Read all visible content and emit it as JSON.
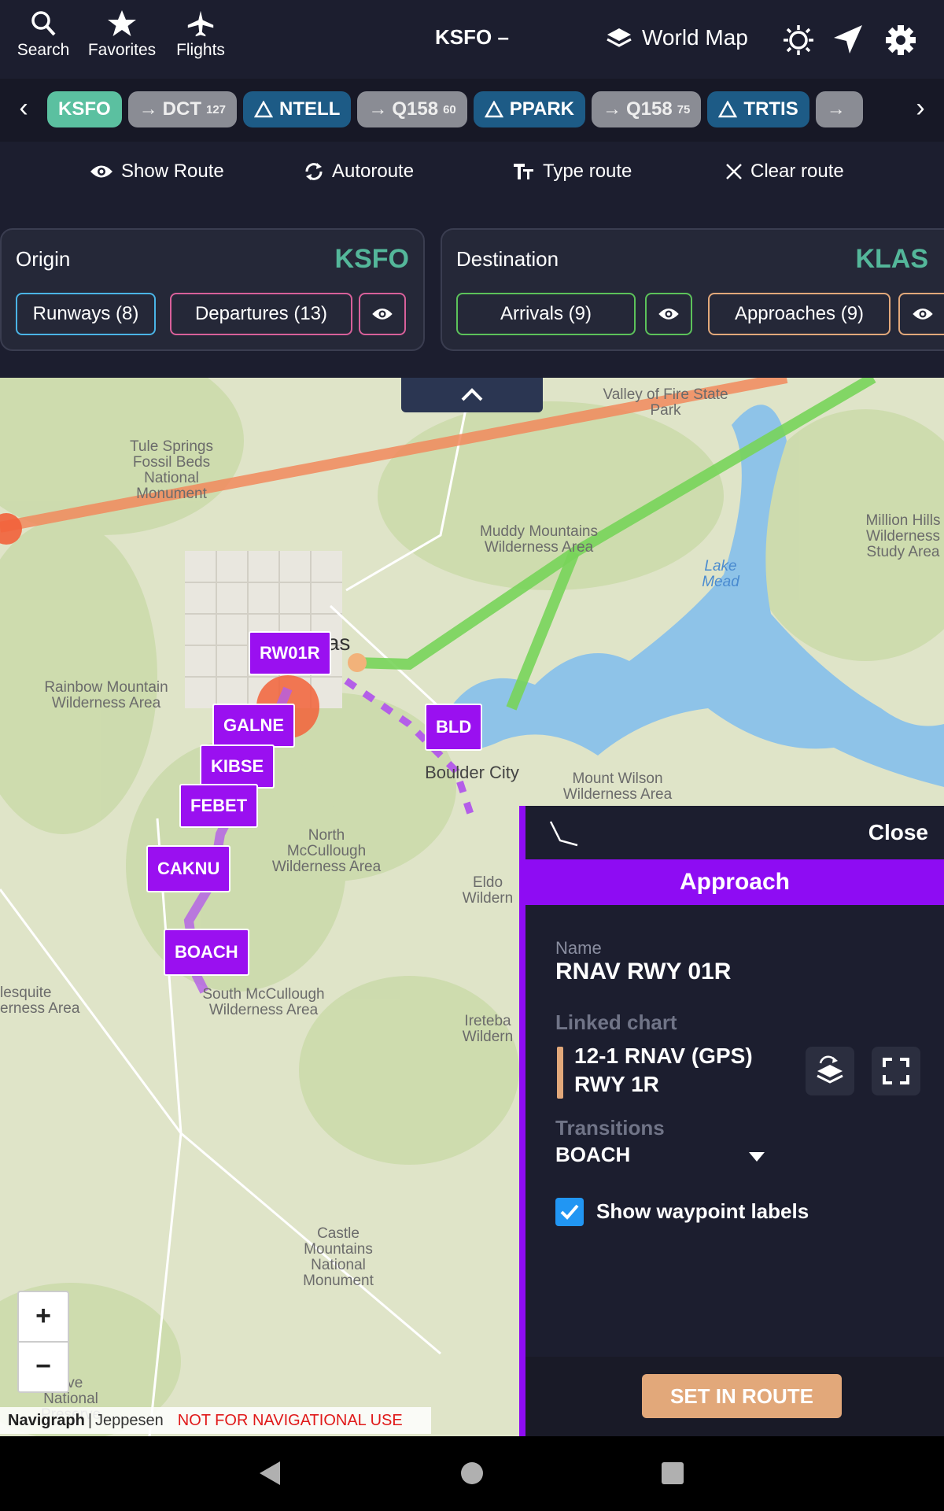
{
  "topbar": {
    "search_label": "Search",
    "favorites_label": "Favorites",
    "flights_label": "Flights",
    "route_title": "KSFO –",
    "world_map_label": "World Map"
  },
  "route_chips": [
    {
      "type": "origin",
      "label": "KSFO",
      "sub": ""
    },
    {
      "type": "airway",
      "label": "DCT",
      "sub": "127"
    },
    {
      "type": "fix",
      "label": "NTELL",
      "sub": ""
    },
    {
      "type": "airway",
      "label": "Q158",
      "sub": "60"
    },
    {
      "type": "fix",
      "label": "PPARK",
      "sub": ""
    },
    {
      "type": "airway",
      "label": "Q158",
      "sub": "75"
    },
    {
      "type": "fix",
      "label": "TRTIS",
      "sub": ""
    }
  ],
  "actions": {
    "show_route": "Show Route",
    "autoroute": "Autoroute",
    "type_route": "Type route",
    "clear_route": "Clear route"
  },
  "origin": {
    "title": "Origin",
    "code": "KSFO",
    "runways_label": "Runways (8)",
    "departures_label": "Departures (13)"
  },
  "destination": {
    "title": "Destination",
    "code": "KLAS",
    "arrivals_label": "Arrivals (9)",
    "approaches_label": "Approaches (9)"
  },
  "map": {
    "labels": {
      "valley_of_fire": "Valley of Fire State Park",
      "tule_springs": "Tule Springs Fossil Beds National Monument",
      "muddy_mountains": "Muddy Mountains Wilderness Area",
      "million_hills": "Million Hills Wilderness Study Area",
      "lake_mead": "Lake Mead",
      "las_vegas": "Las Vegas",
      "rainbow_mountain": "Rainbow Mountain Wilderness Area",
      "boulder_city": "Boulder City",
      "mount_wilson": "Mount Wilson Wilderness Area",
      "north_mccullough": "North McCullough Wilderness Area",
      "eldorado": "Eldo Wildern",
      "mesquite": "lesquite erness Area",
      "south_mccullough": "South McCullough Wilderness Area",
      "ireteba": "Ireteba Wildern",
      "castle_mountains": "Castle Mountains National Monument",
      "mojave": "ave National Preserve"
    },
    "waypoints": [
      "RW01R",
      "GALNE",
      "KIBSE",
      "FEBET",
      "CAKNU",
      "BOACH",
      "BLD"
    ],
    "zoom_in": "+",
    "zoom_out": "−",
    "attribution": {
      "brand": "Navigraph",
      "separator": "|",
      "provider": "Jeppesen",
      "warning": "NOT FOR NAVIGATIONAL USE"
    }
  },
  "approach_panel": {
    "close_label": "Close",
    "title": "Approach",
    "name_label": "Name",
    "name_value": "RNAV RWY 01R",
    "linked_chart_label": "Linked chart",
    "linked_chart_line1": "12-1 RNAV (GPS)",
    "linked_chart_line2": "RWY 1R",
    "transitions_label": "Transitions",
    "transition_value": "BOACH",
    "show_waypoint_labels": "Show waypoint labels",
    "show_waypoint_labels_checked": true,
    "set_in_route": "SET IN ROUTE"
  },
  "colors": {
    "accent_purple": "#8e0cf3",
    "origin_green": "#54b79a",
    "route_orange": "#e2a87a",
    "fix_blue": "#1d5b86"
  }
}
